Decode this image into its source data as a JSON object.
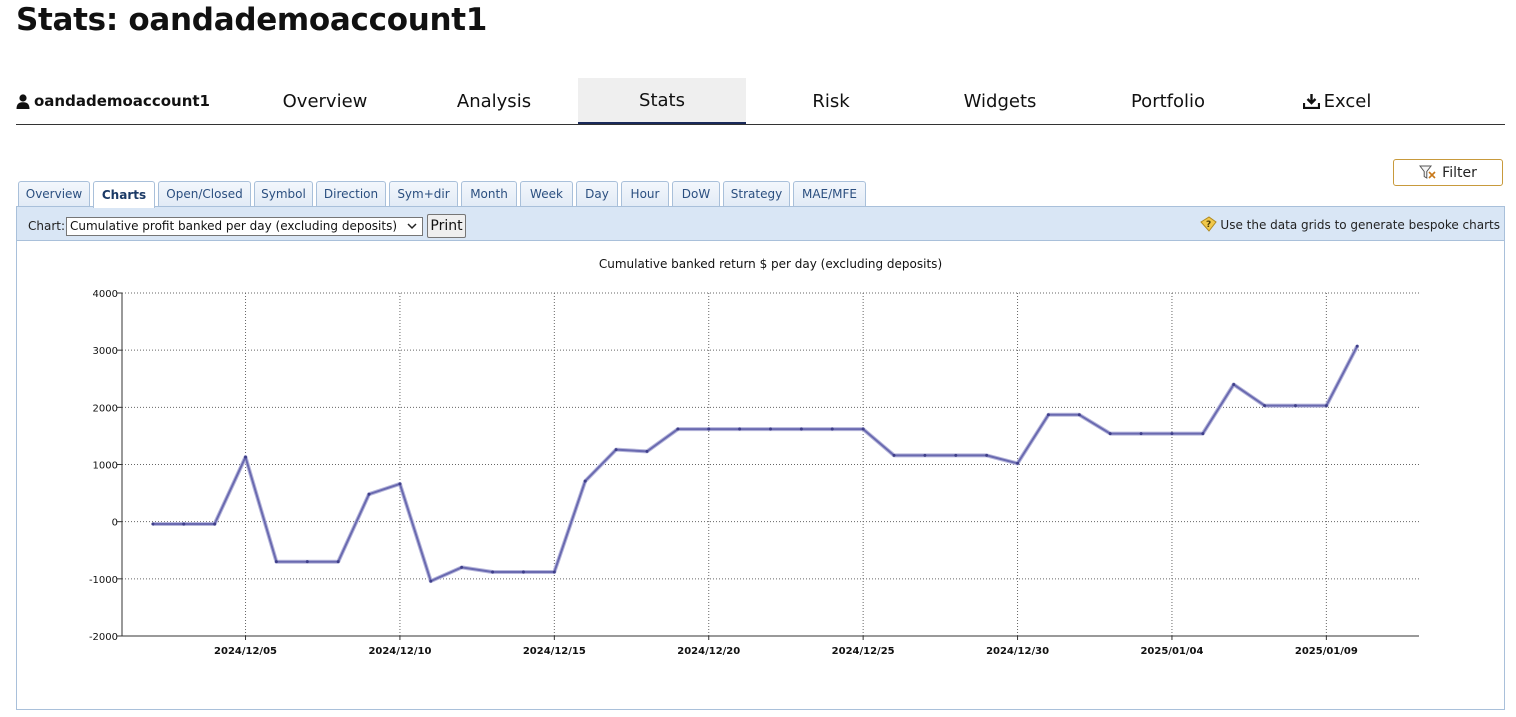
{
  "page": {
    "title": "Stats: oandademoaccount1"
  },
  "nav": {
    "account": "oandademoaccount1",
    "tabs": [
      {
        "label": "Overview"
      },
      {
        "label": "Analysis"
      },
      {
        "label": "Stats",
        "active": true
      },
      {
        "label": "Risk"
      },
      {
        "label": "Widgets"
      },
      {
        "label": "Portfolio"
      },
      {
        "label": "Excel",
        "icon": "download-icon"
      }
    ]
  },
  "filter": {
    "label": "Filter",
    "icon": "funnel-icon"
  },
  "subtabs": [
    {
      "label": "Overview"
    },
    {
      "label": "Charts",
      "active": true
    },
    {
      "label": "Open/Closed"
    },
    {
      "label": "Symbol"
    },
    {
      "label": "Direction"
    },
    {
      "label": "Sym+dir"
    },
    {
      "label": "Month"
    },
    {
      "label": "Week"
    },
    {
      "label": "Day"
    },
    {
      "label": "Hour"
    },
    {
      "label": "DoW"
    },
    {
      "label": "Strategy"
    },
    {
      "label": "MAE/MFE"
    }
  ],
  "toolbar": {
    "chart_label": "Chart:",
    "chart_select_value": "Cumulative profit banked per day (excluding deposits)",
    "print_label": "Print",
    "hint": "Use the data grids to generate bespoke charts",
    "hint_icon": "tip-icon"
  },
  "chart_data": {
    "type": "line",
    "title": "Cumulative banked return $ per day (excluding deposits)",
    "xlabel": "",
    "ylabel": "",
    "ylim": [
      -2000,
      4000
    ],
    "yticks": [
      4000,
      3000,
      2000,
      1000,
      0,
      -1000,
      -2000
    ],
    "xticks": [
      "2024/12/05",
      "2024/12/10",
      "2024/12/15",
      "2024/12/20",
      "2024/12/25",
      "2024/12/30",
      "2025/01/04",
      "2025/01/09"
    ],
    "xlim": [
      "2024/12/01",
      "2025/01/12"
    ],
    "grid": true,
    "color": "#6a6ab0",
    "series": [
      {
        "x": [
          "2024/12/02",
          "2024/12/03",
          "2024/12/04",
          "2024/12/05",
          "2024/12/06",
          "2024/12/07",
          "2024/12/08",
          "2024/12/09",
          "2024/12/10",
          "2024/12/11",
          "2024/12/12",
          "2024/12/13",
          "2024/12/14",
          "2024/12/15",
          "2024/12/16",
          "2024/12/17",
          "2024/12/18",
          "2024/12/19",
          "2024/12/20",
          "2024/12/21",
          "2024/12/22",
          "2024/12/23",
          "2024/12/24",
          "2024/12/25",
          "2024/12/26",
          "2024/12/27",
          "2024/12/28",
          "2024/12/29",
          "2024/12/30",
          "2024/12/31",
          "2025/01/01",
          "2025/01/02",
          "2025/01/03",
          "2025/01/04",
          "2025/01/05",
          "2025/01/06",
          "2025/01/07",
          "2025/01/08",
          "2025/01/09",
          "2025/01/10"
        ],
        "values": [
          -40,
          -40,
          -40,
          1130,
          -700,
          -700,
          -700,
          480,
          660,
          -1040,
          -800,
          -880,
          -880,
          -880,
          710,
          1260,
          1230,
          1620,
          1620,
          1620,
          1620,
          1620,
          1620,
          1620,
          1160,
          1160,
          1160,
          1160,
          1020,
          1870,
          1870,
          1540,
          1540,
          1540,
          1540,
          2400,
          2030,
          2030,
          2030,
          3070
        ]
      }
    ]
  }
}
